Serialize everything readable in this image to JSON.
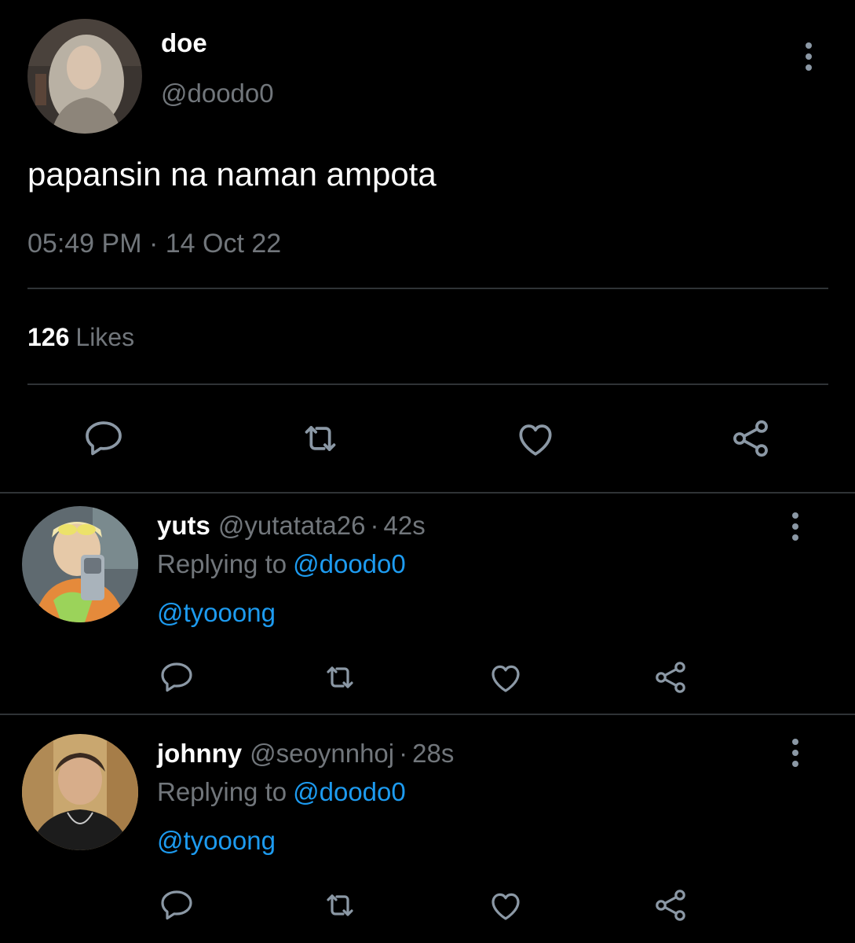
{
  "tweet": {
    "author_name": "doe",
    "author_handle": "@doodo0",
    "text": "papansin na naman ampota",
    "time": "05:49 PM",
    "separator": "·",
    "date": "14 Oct 22",
    "likes_count": "126",
    "likes_label": "Likes"
  },
  "replies": [
    {
      "name": "yuts",
      "handle": "@yutatata26",
      "separator": "·",
      "time": "42s",
      "replying_label": "Replying to",
      "replying_user": "@doodo0",
      "text": "@tyooong"
    },
    {
      "name": "johnny",
      "handle": "@seoynnhoj",
      "separator": "·",
      "time": "28s",
      "replying_label": "Replying to",
      "replying_user": "@doodo0",
      "text": "@tyooong"
    }
  ],
  "colors": {
    "background": "#000000",
    "primary_text": "#ffffff",
    "secondary_text": "#71767b",
    "link": "#1d9bf0",
    "divider": "#2f3336",
    "icon": "#8b98a5"
  },
  "icons": {
    "reply": "comment-icon",
    "retweet": "retweet-icon",
    "like": "heart-icon",
    "share": "share-icon",
    "more": "more-vertical-icon"
  }
}
